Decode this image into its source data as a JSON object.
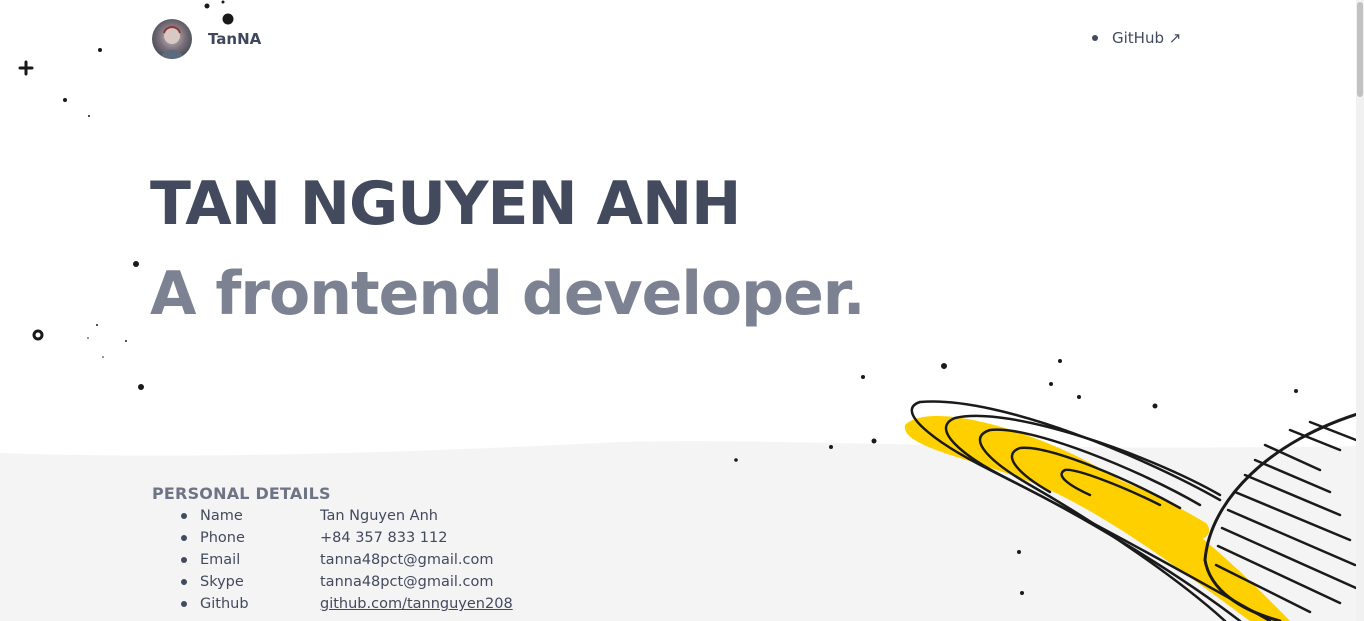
{
  "header": {
    "brand": "TanNA",
    "nav": [
      {
        "label": "GitHub ↗"
      }
    ]
  },
  "hero": {
    "name": "TAN NGUYEN ANH",
    "role": "A frontend developer."
  },
  "personal_details": {
    "title": "PERSONAL DETAILS",
    "items": [
      {
        "key": "Name",
        "value": "Tan Nguyen Anh"
      },
      {
        "key": "Phone",
        "value": "+84 357 833 112"
      },
      {
        "key": "Email",
        "value": "tanna48pct@gmail.com"
      },
      {
        "key": "Skype",
        "value": "tanna48pct@gmail.com"
      },
      {
        "key": "Github",
        "value": "github.com/tannguyen208"
      }
    ]
  },
  "colors": {
    "text": "#434a5e",
    "muted": "#7d8292",
    "band": "#f4f4f5",
    "ring_accent": "#ffd000"
  }
}
